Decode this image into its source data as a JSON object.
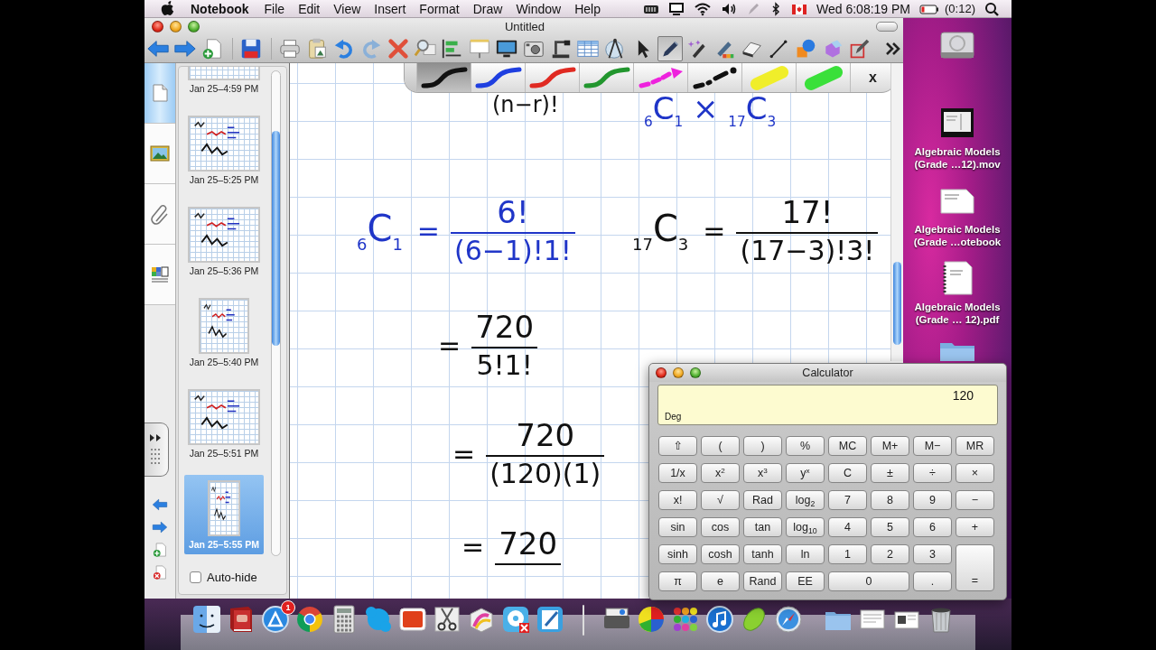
{
  "menu_bar": {
    "app_name": "Notebook",
    "menus": [
      "File",
      "Edit",
      "View",
      "Insert",
      "Format",
      "Draw",
      "Window",
      "Help"
    ],
    "clock": "Wed 6:08:19 PM",
    "battery_time": "(0:12)"
  },
  "window": {
    "title": "Untitled"
  },
  "drawing_tools": [
    {
      "kind": "select",
      "selected": false
    },
    {
      "kind": "pen",
      "selected": true
    },
    {
      "kind": "magic-pen",
      "selected": false
    },
    {
      "kind": "creative-pen",
      "selected": false
    },
    {
      "kind": "eraser",
      "selected": false
    },
    {
      "kind": "line",
      "selected": false
    },
    {
      "kind": "shapes",
      "selected": false
    },
    {
      "kind": "shape-3d",
      "selected": false
    },
    {
      "kind": "pencil-box",
      "selected": false
    }
  ],
  "side_tabs": [
    {
      "kind": "pages",
      "selected": true
    },
    {
      "kind": "gallery",
      "selected": false
    },
    {
      "kind": "attachments",
      "selected": false
    },
    {
      "kind": "properties",
      "selected": false
    }
  ],
  "page_sorter": {
    "pages": [
      {
        "kind": "wide",
        "date": "Jan 25–4:59 PM",
        "selected": false
      },
      {
        "kind": "wide",
        "date": "Jan 25–5:25 PM",
        "selected": false
      },
      {
        "kind": "wide",
        "date": "Jan 25–5:36 PM",
        "selected": false
      },
      {
        "kind": "square",
        "date": "Jan 25–5:40 PM",
        "selected": false
      },
      {
        "kind": "wide",
        "date": "Jan 25–5:51 PM",
        "selected": false
      },
      {
        "kind": "narrow",
        "date": "Jan 25–5:55 PM",
        "selected": true
      }
    ],
    "auto_hide": {
      "label": "Auto-hide",
      "checked": false
    }
  },
  "pen_toolbar": {
    "styles": [
      {
        "kind": "line",
        "color": "#111111",
        "selected": true
      },
      {
        "kind": "line",
        "color": "#1f3fe0",
        "selected": false
      },
      {
        "kind": "line",
        "color": "#e02a22",
        "selected": false
      },
      {
        "kind": "line",
        "color": "#22962e",
        "selected": false
      },
      {
        "kind": "arrow",
        "color": "#ee22dd",
        "selected": false
      },
      {
        "kind": "dash-dot",
        "color": "#111111",
        "selected": false
      },
      {
        "kind": "highlighter",
        "color": "#f0ee2a",
        "selected": false
      },
      {
        "kind": "highlighter",
        "color": "#3ae03a",
        "selected": false
      }
    ],
    "close": "x"
  },
  "canvas": {
    "notes": [
      {
        "kind": "term",
        "color": "#111111",
        "text": "(n−r)!"
      },
      {
        "kind": "term",
        "color": "#1f35c8",
        "text": "$_{6}$C$_{1}$ × $_{17}$C$_{3}$"
      },
      {
        "kind": "fraction",
        "color": "#1f35c8",
        "lead": "$_{6}$C$_{1}$",
        "relation": "=",
        "numerator": "6!",
        "denominator": "(6−1)!1!"
      },
      {
        "kind": "fraction",
        "color": "#111111",
        "lead": "$_{17}$C$_{3}$",
        "relation": "=",
        "numerator": "17!",
        "denominator": "(17−3)!3!"
      },
      {
        "kind": "fraction",
        "color": "#111111",
        "relation": "=",
        "numerator": "720",
        "denominator": "5!1!"
      },
      {
        "kind": "fraction",
        "color": "#111111",
        "relation": "=",
        "numerator": "720",
        "denominator": "(120)(1)"
      },
      {
        "kind": "fraction",
        "color": "#111111",
        "relation": "=",
        "numerator": "720"
      }
    ]
  },
  "calculator": {
    "title": "Calculator",
    "display": "120",
    "angle_mode": "Deg",
    "keys": [
      {
        "label": "⇧",
        "kind": "key"
      },
      {
        "label": "(",
        "kind": "key"
      },
      {
        "label": ")",
        "kind": "key"
      },
      {
        "label": "%",
        "kind": "key"
      },
      {
        "label": "MC",
        "kind": "key"
      },
      {
        "label": "M+",
        "kind": "key"
      },
      {
        "label": "M−",
        "kind": "key"
      },
      {
        "label": "MR",
        "kind": "key"
      },
      {
        "label": "1/x",
        "kind": "key"
      },
      {
        "label": "x$^{2}$",
        "kind": "key"
      },
      {
        "label": "x$^{3}$",
        "kind": "key"
      },
      {
        "label": "y$^{x}$",
        "kind": "key"
      },
      {
        "label": "C",
        "kind": "key"
      },
      {
        "label": "±",
        "kind": "key"
      },
      {
        "label": "÷",
        "kind": "key"
      },
      {
        "label": "×",
        "kind": "key"
      },
      {
        "label": "x!",
        "kind": "key"
      },
      {
        "label": "√",
        "kind": "key"
      },
      {
        "label": "Rad",
        "kind": "key"
      },
      {
        "label": "log$_{2}$",
        "kind": "key"
      },
      {
        "label": "7",
        "kind": "key"
      },
      {
        "label": "8",
        "kind": "key"
      },
      {
        "label": "9",
        "kind": "key"
      },
      {
        "label": "−",
        "kind": "key"
      },
      {
        "label": "sin",
        "kind": "key"
      },
      {
        "label": "cos",
        "kind": "key"
      },
      {
        "label": "tan",
        "kind": "key"
      },
      {
        "label": "log$_{10}$",
        "kind": "key"
      },
      {
        "label": "4",
        "kind": "key"
      },
      {
        "label": "5",
        "kind": "key"
      },
      {
        "label": "6",
        "kind": "key"
      },
      {
        "label": "+",
        "kind": "key"
      },
      {
        "label": "sinh",
        "kind": "key"
      },
      {
        "label": "cosh",
        "kind": "key"
      },
      {
        "label": "tanh",
        "kind": "key"
      },
      {
        "label": "ln",
        "kind": "key"
      },
      {
        "label": "1",
        "kind": "key"
      },
      {
        "label": "2",
        "kind": "key"
      },
      {
        "label": "3",
        "kind": "key"
      },
      {
        "label": "π",
        "kind": "key"
      },
      {
        "label": "e",
        "kind": "key"
      },
      {
        "label": "Rand",
        "kind": "key"
      },
      {
        "label": "EE",
        "kind": "key"
      },
      {
        "label": "0",
        "kind": "wide"
      },
      {
        "label": ".",
        "kind": "key"
      },
      {
        "label": "=",
        "kind": "tall"
      }
    ]
  },
  "desktop_icons": [
    {
      "kind": "drive"
    },
    {
      "kind": "movie",
      "label": "Algebraic Models (Grade …12).mov"
    },
    {
      "kind": "document",
      "label": "Algebraic Models (Grade …otebook"
    },
    {
      "kind": "pdf",
      "label": "Algebraic Models (Grade … 12).pdf"
    },
    {
      "kind": "folder"
    }
  ],
  "dock": {
    "badge": "1"
  }
}
